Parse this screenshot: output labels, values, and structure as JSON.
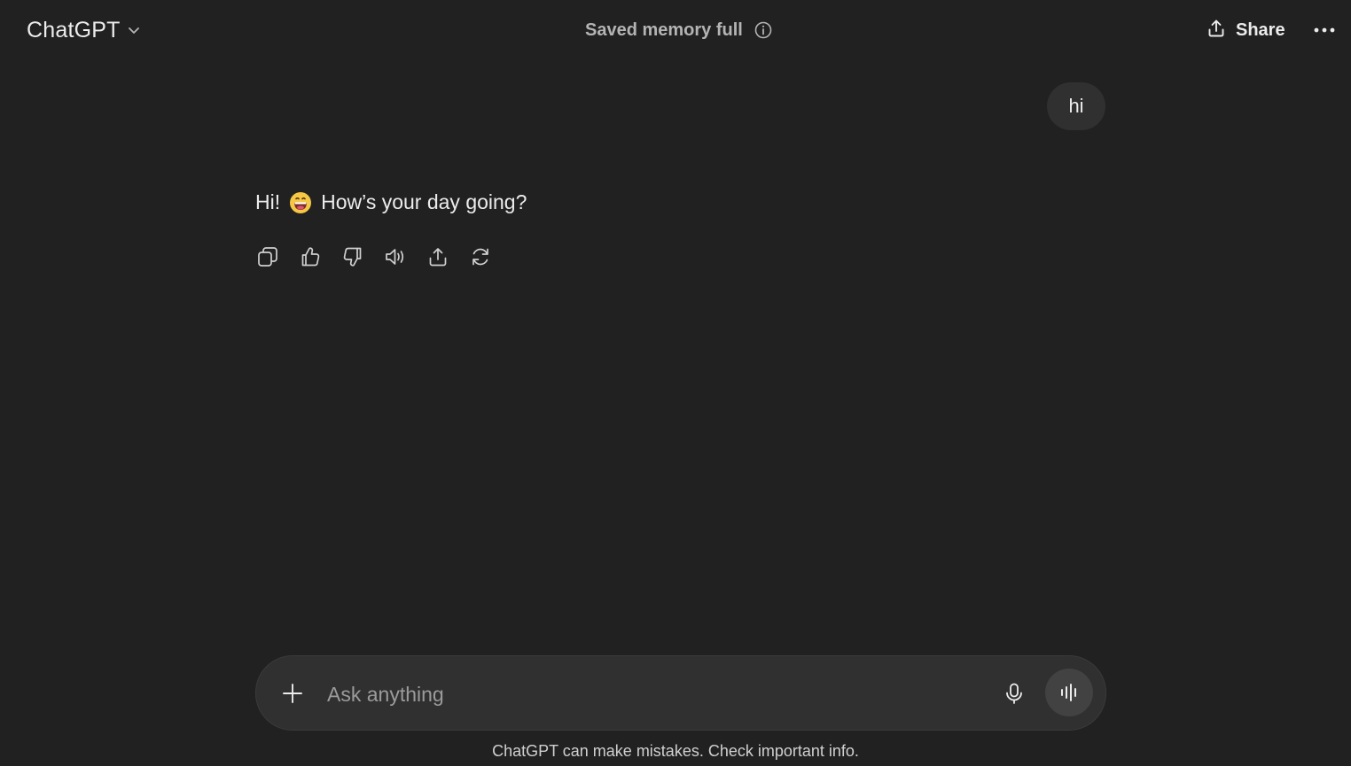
{
  "header": {
    "model_name": "ChatGPT",
    "memory_status": "Saved memory full",
    "share_label": "Share"
  },
  "messages": {
    "user_text": "hi",
    "assistant_text_before_emoji": "Hi!",
    "assistant_text_after_emoji": "How’s your day going?",
    "assistant_emoji": "grinning-face-emoji"
  },
  "actions": [
    {
      "icon": "copy-icon"
    },
    {
      "icon": "thumbs-up-icon"
    },
    {
      "icon": "thumbs-down-icon"
    },
    {
      "icon": "read-aloud-icon"
    },
    {
      "icon": "share-icon"
    },
    {
      "icon": "regenerate-icon"
    }
  ],
  "composer": {
    "placeholder": "Ask anything",
    "value": ""
  },
  "footer": {
    "disclaimer": "ChatGPT can make mistakes. Check important info."
  },
  "colors": {
    "background": "#212121",
    "bubble": "#303030",
    "text": "#ececec",
    "muted": "#b4b4b4",
    "voice_button": "#424242"
  }
}
